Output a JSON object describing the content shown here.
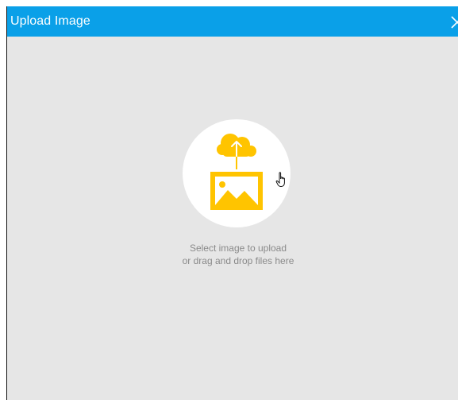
{
  "dialog": {
    "title": "Upload Image",
    "close_icon": "close-icon"
  },
  "upload": {
    "icon": "cloud-upload-image-icon",
    "hint_line1": "Select image to upload",
    "hint_line2": "or drag and drop files here"
  },
  "colors": {
    "titlebar": "#0aa0e8",
    "background": "#e6e6e6",
    "accent": "#ffc400",
    "hint_text": "#8a8a8a"
  }
}
